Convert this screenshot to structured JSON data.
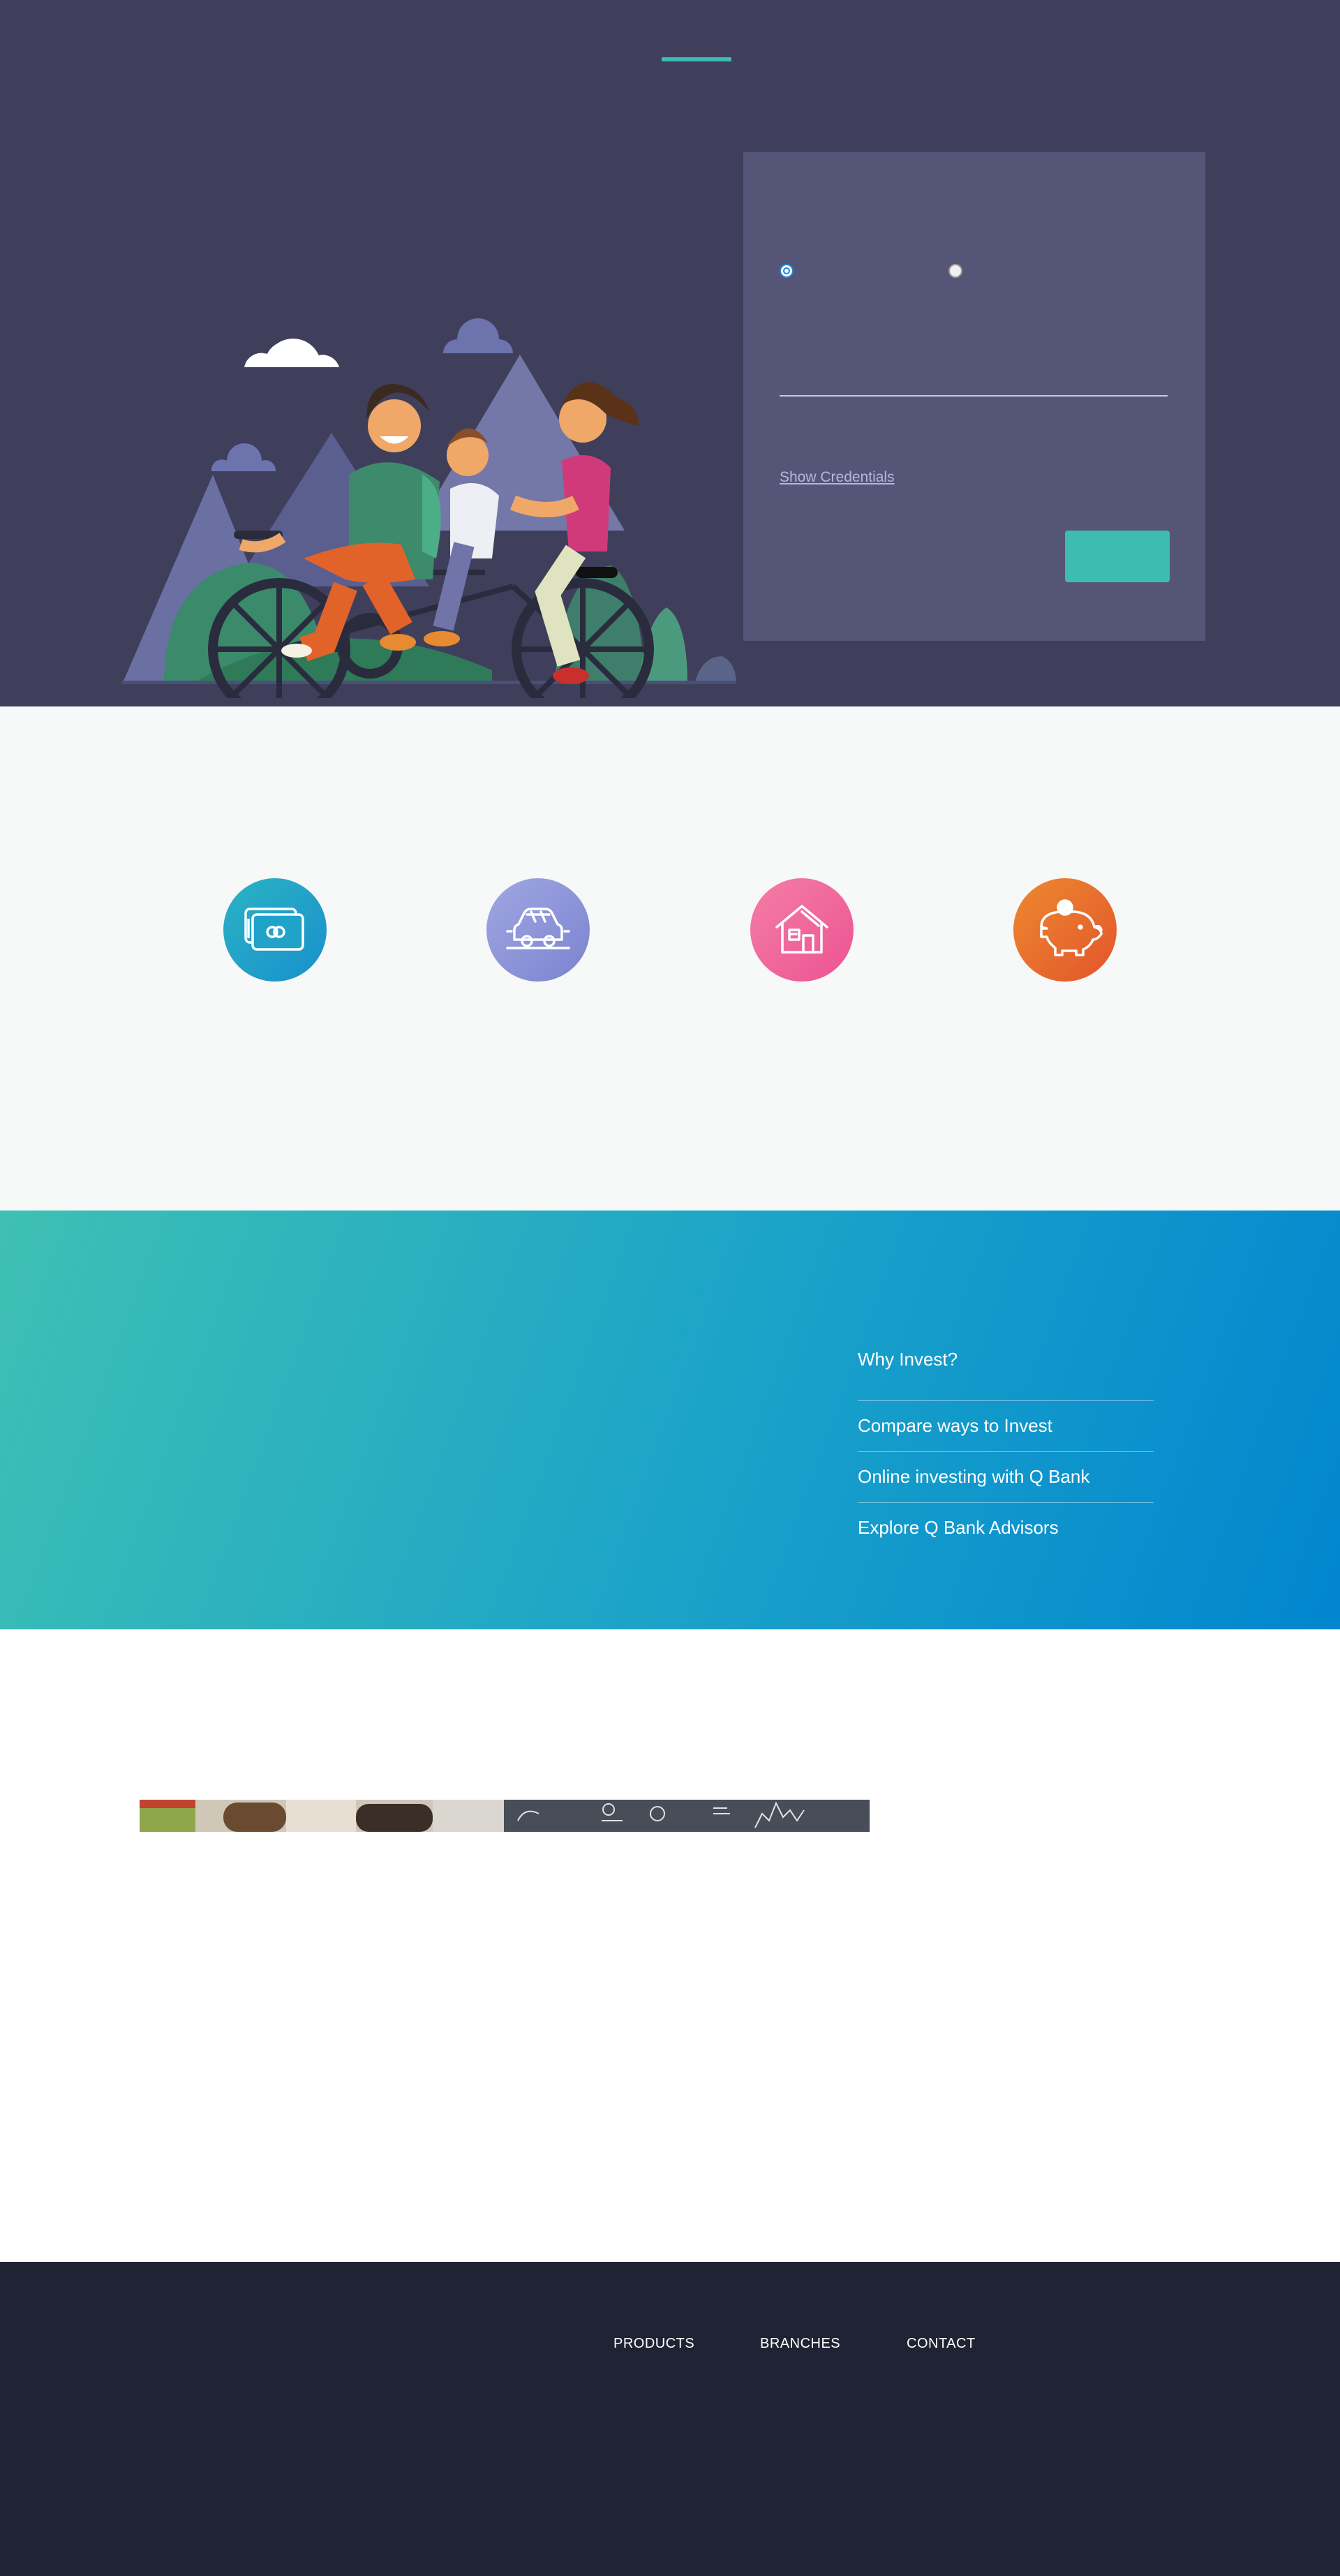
{
  "login": {
    "show_credentials_label": "Show Credentials"
  },
  "features": {
    "items": [
      {
        "icon": "cash-card-icon",
        "color_from": "#2ab3c4",
        "color_to": "#1990cc"
      },
      {
        "icon": "car-icon",
        "color_from": "#a0a7e2",
        "color_to": "#7b83d0"
      },
      {
        "icon": "house-icon",
        "color_from": "#f47ea4",
        "color_to": "#ec5394"
      },
      {
        "icon": "piggy-bank-icon",
        "color_from": "#ec8a2f",
        "color_to": "#e3542c"
      }
    ]
  },
  "invest": {
    "menu": [
      "Why Invest?",
      "Compare ways to Invest",
      "Online investing with Q Bank",
      "Explore Q Bank Advisors"
    ]
  },
  "footer": {
    "links": [
      "PRODUCTS",
      "BRANCHES",
      "CONTACT"
    ]
  },
  "colors": {
    "hero_bg": "#3f3f5c",
    "panel_bg": "#555577",
    "accent_teal": "#3dbcb4",
    "features_bg": "#f7f8f8",
    "footer_bg": "#1f2333"
  }
}
